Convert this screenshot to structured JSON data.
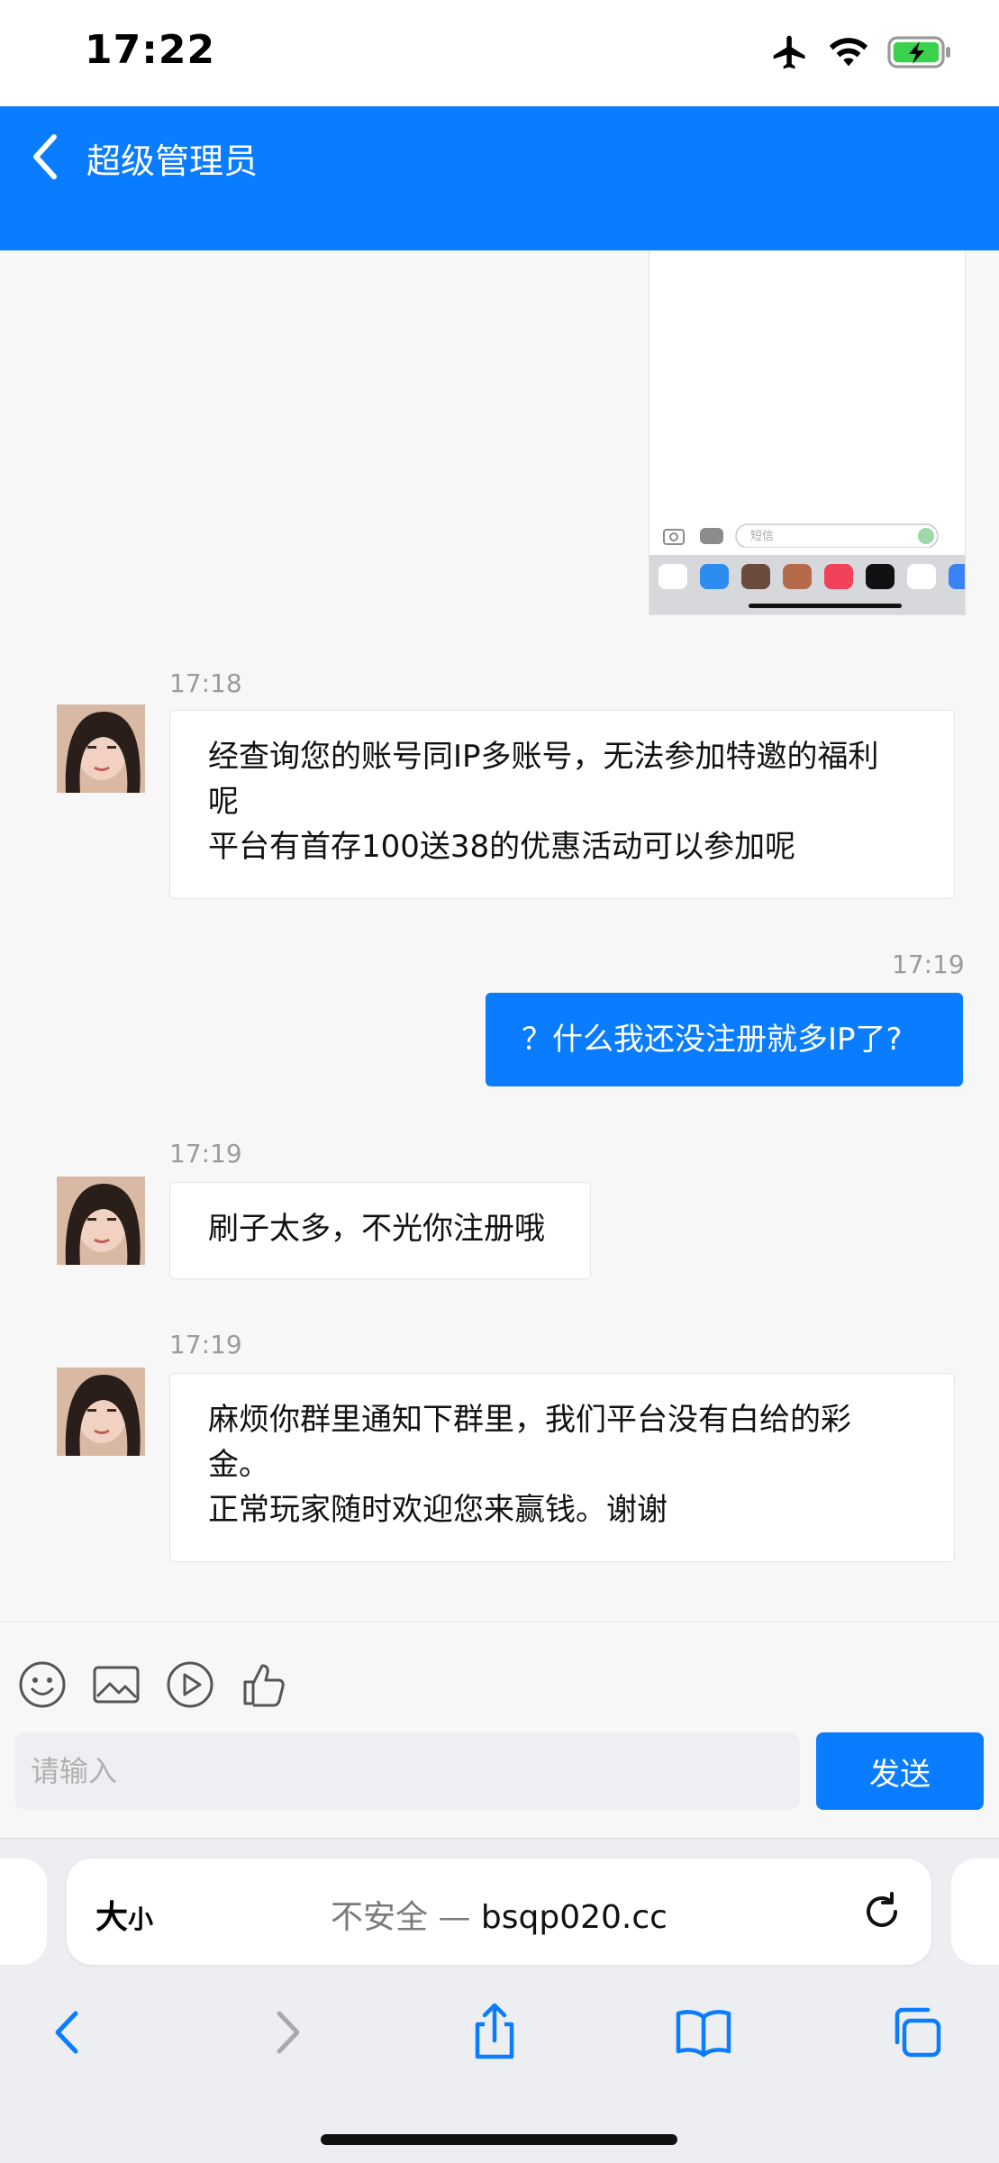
{
  "status_bar": {
    "time": "17:22"
  },
  "header": {
    "title": "超级管理员"
  },
  "screenshot_thumb": {
    "input_placeholder": "短信"
  },
  "messages": [
    {
      "direction": "incoming",
      "time": "17:18",
      "lines": [
        "经查询您的账号同IP多账号，无法参加特邀的福利",
        "呢",
        "平台有首存100送38的优惠活动可以参加呢"
      ]
    },
    {
      "direction": "outgoing",
      "time": "17:19",
      "text": "？什么我还没注册就多IP了?"
    },
    {
      "direction": "incoming",
      "time": "17:19",
      "lines": [
        "刷子太多，不光你注册哦"
      ]
    },
    {
      "direction": "incoming",
      "time": "17:19",
      "lines": [
        "麻烦你群里通知下群里，我们平台没有白给的彩",
        "金。",
        "正常玩家随时欢迎您来赢钱。谢谢"
      ]
    }
  ],
  "composer": {
    "placeholder": "请输入",
    "send_label": "发送"
  },
  "browser": {
    "text_size_big": "大",
    "text_size_small": "小",
    "insecure_label": "不安全 — ",
    "domain": "bsqp020.cc"
  },
  "colors": {
    "accent": "#0a7cff",
    "battery": "#3ad14d"
  }
}
